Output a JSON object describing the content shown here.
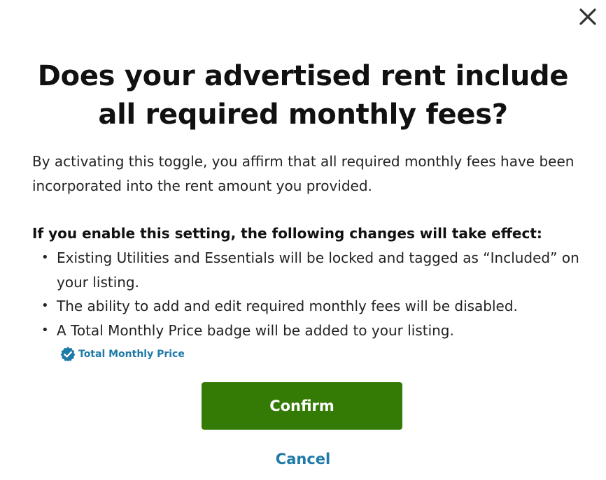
{
  "dialog": {
    "close_icon": "close-icon",
    "title": "Does your advertised rent include all required monthly fees?",
    "intro": "By activating this toggle, you affirm that all required monthly fees have been incorporated into the rent amount you provided.",
    "changes_heading": "If you enable this setting, the following changes will take effect:",
    "changes": [
      "Existing Utilities and Essentials will be locked and tagged as “Included” on your listing.",
      "The ability to add and edit required monthly fees will be disabled.",
      "A Total Monthly Price badge will be added to your listing."
    ],
    "bullet": "•",
    "badge": {
      "icon": "verified-check-icon",
      "label": "Total Monthly Price"
    },
    "confirm_label": "Confirm",
    "cancel_label": "Cancel"
  },
  "colors": {
    "primary_button": "#347b05",
    "link": "#1f7aa8",
    "badge": "#1f7aa8",
    "text": "#222222"
  }
}
